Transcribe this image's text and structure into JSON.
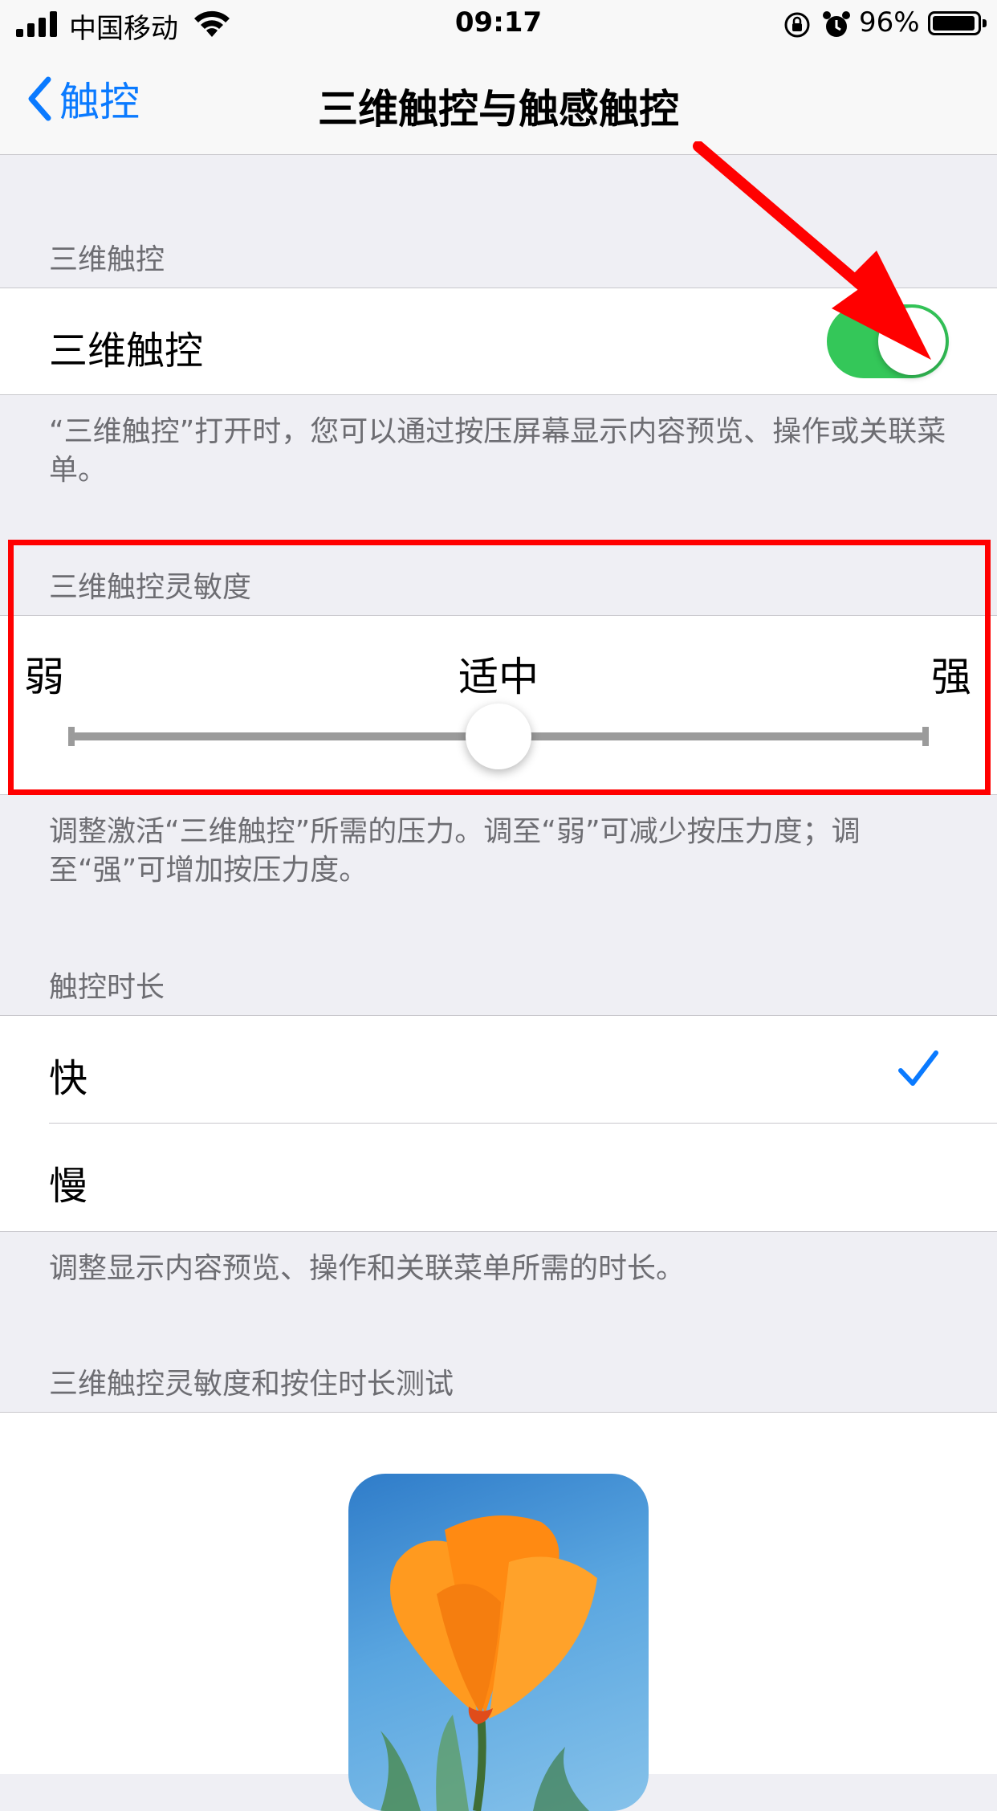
{
  "status_bar": {
    "carrier": "中国移动",
    "time": "09:17",
    "battery_percent": "96%",
    "battery_level": 0.96
  },
  "nav": {
    "back_label": "触控",
    "title": "三维触控与触感触控"
  },
  "section_3d": {
    "header": "三维触控",
    "toggle_label": "三维触控",
    "toggle_on": true,
    "footer": "“三维触控”打开时，您可以通过按压屏幕显示内容预览、操作或关联菜单。"
  },
  "sensitivity": {
    "header": "三维触控灵敏度",
    "label_weak": "弱",
    "label_medium": "适中",
    "label_strong": "强",
    "slider_value": 0.5,
    "footer": "调整激活“三维触控”所需的压力。调至“弱”可减少按压力度；调至“强”可增加按压力度。"
  },
  "duration": {
    "header": "触控时长",
    "options": [
      {
        "label": "快",
        "selected": true
      },
      {
        "label": "慢",
        "selected": false
      }
    ],
    "footer": "调整显示内容预览、操作和关联菜单所需的时长。"
  },
  "test": {
    "header": "三维触控灵敏度和按住时长测试"
  },
  "colors": {
    "accent": "#0a7aff",
    "toggle_on": "#34c759",
    "annotation": "#ff0000"
  }
}
